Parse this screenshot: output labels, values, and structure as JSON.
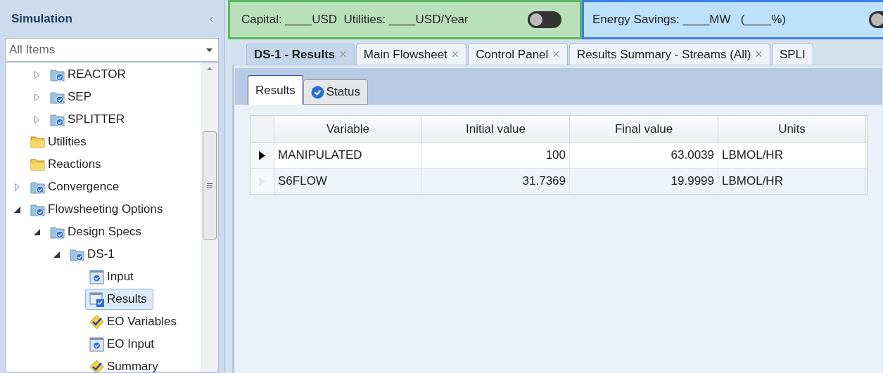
{
  "sidebar": {
    "title": "Simulation",
    "collapse": "‹",
    "filter": {
      "value": "All Items"
    },
    "tree": [
      {
        "children": [
          {
            "label": "REACTOR",
            "kind": "checked-folder",
            "expanded": false,
            "selected": false
          },
          {
            "label": "SEP",
            "kind": "checked-folder",
            "expanded": false,
            "selected": false
          },
          {
            "label": "SPLITTER",
            "kind": "checked-folder",
            "expanded": false,
            "selected": false
          }
        ]
      },
      {
        "label": "Utilities",
        "kind": "folder",
        "selected": false
      },
      {
        "label": "Reactions",
        "kind": "folder",
        "selected": false
      },
      {
        "label": "Convergence",
        "kind": "checked-folder",
        "expanded": false,
        "selected": false
      },
      {
        "label": "Flowsheeting Options",
        "kind": "checked-folder",
        "expanded": true,
        "selected": false,
        "children": [
          {
            "label": "Design Specs",
            "kind": "checked-folder",
            "expanded": true,
            "selected": false,
            "children": [
              {
                "label": "DS-1",
                "kind": "checked-folder",
                "expanded": true,
                "selected": false,
                "children": [
                  {
                    "label": "Input",
                    "kind": "form",
                    "selected": false
                  },
                  {
                    "label": "Results",
                    "kind": "results-form",
                    "selected": true
                  },
                  {
                    "label": "EO Variables",
                    "kind": "diamond",
                    "selected": false
                  },
                  {
                    "label": "EO Input",
                    "kind": "form",
                    "selected": false
                  },
                  {
                    "label": "Summary",
                    "kind": "diamond",
                    "selected": false
                  }
                ]
              }
            ]
          }
        ]
      }
    ]
  },
  "cost_bar": {
    "text": "Capital: ____USD  Utilities: ____USD/Year",
    "on": false
  },
  "energy_bar": {
    "text": "Energy Savings: ____MW   (____%)",
    "on": false
  },
  "tabs": [
    {
      "label": "DS-1 - Results",
      "close": "×",
      "selected": true
    },
    {
      "label": "Main Flowsheet",
      "close": "×",
      "selected": false
    },
    {
      "label": "Control Panel",
      "close": "×",
      "selected": false
    },
    {
      "label": "Results Summary - Streams (All)",
      "close": "×",
      "selected": false
    },
    {
      "label": "SPLI",
      "selected": false
    }
  ],
  "subtabs": [
    {
      "label": "Results",
      "selected": true
    },
    {
      "label": "Status",
      "status_ok": true,
      "selected": false
    }
  ],
  "table": {
    "columns": [
      "Variable",
      "Initial value",
      "Final value",
      "Units"
    ],
    "rows": [
      {
        "current": true,
        "cells": [
          "MANIPULATED",
          "100",
          "63.0039",
          "LBMOL/HR"
        ]
      },
      {
        "current": false,
        "cells": [
          "S6FLOW",
          "31.7369",
          "19.9999",
          "LBMOL/HR"
        ]
      }
    ]
  }
}
